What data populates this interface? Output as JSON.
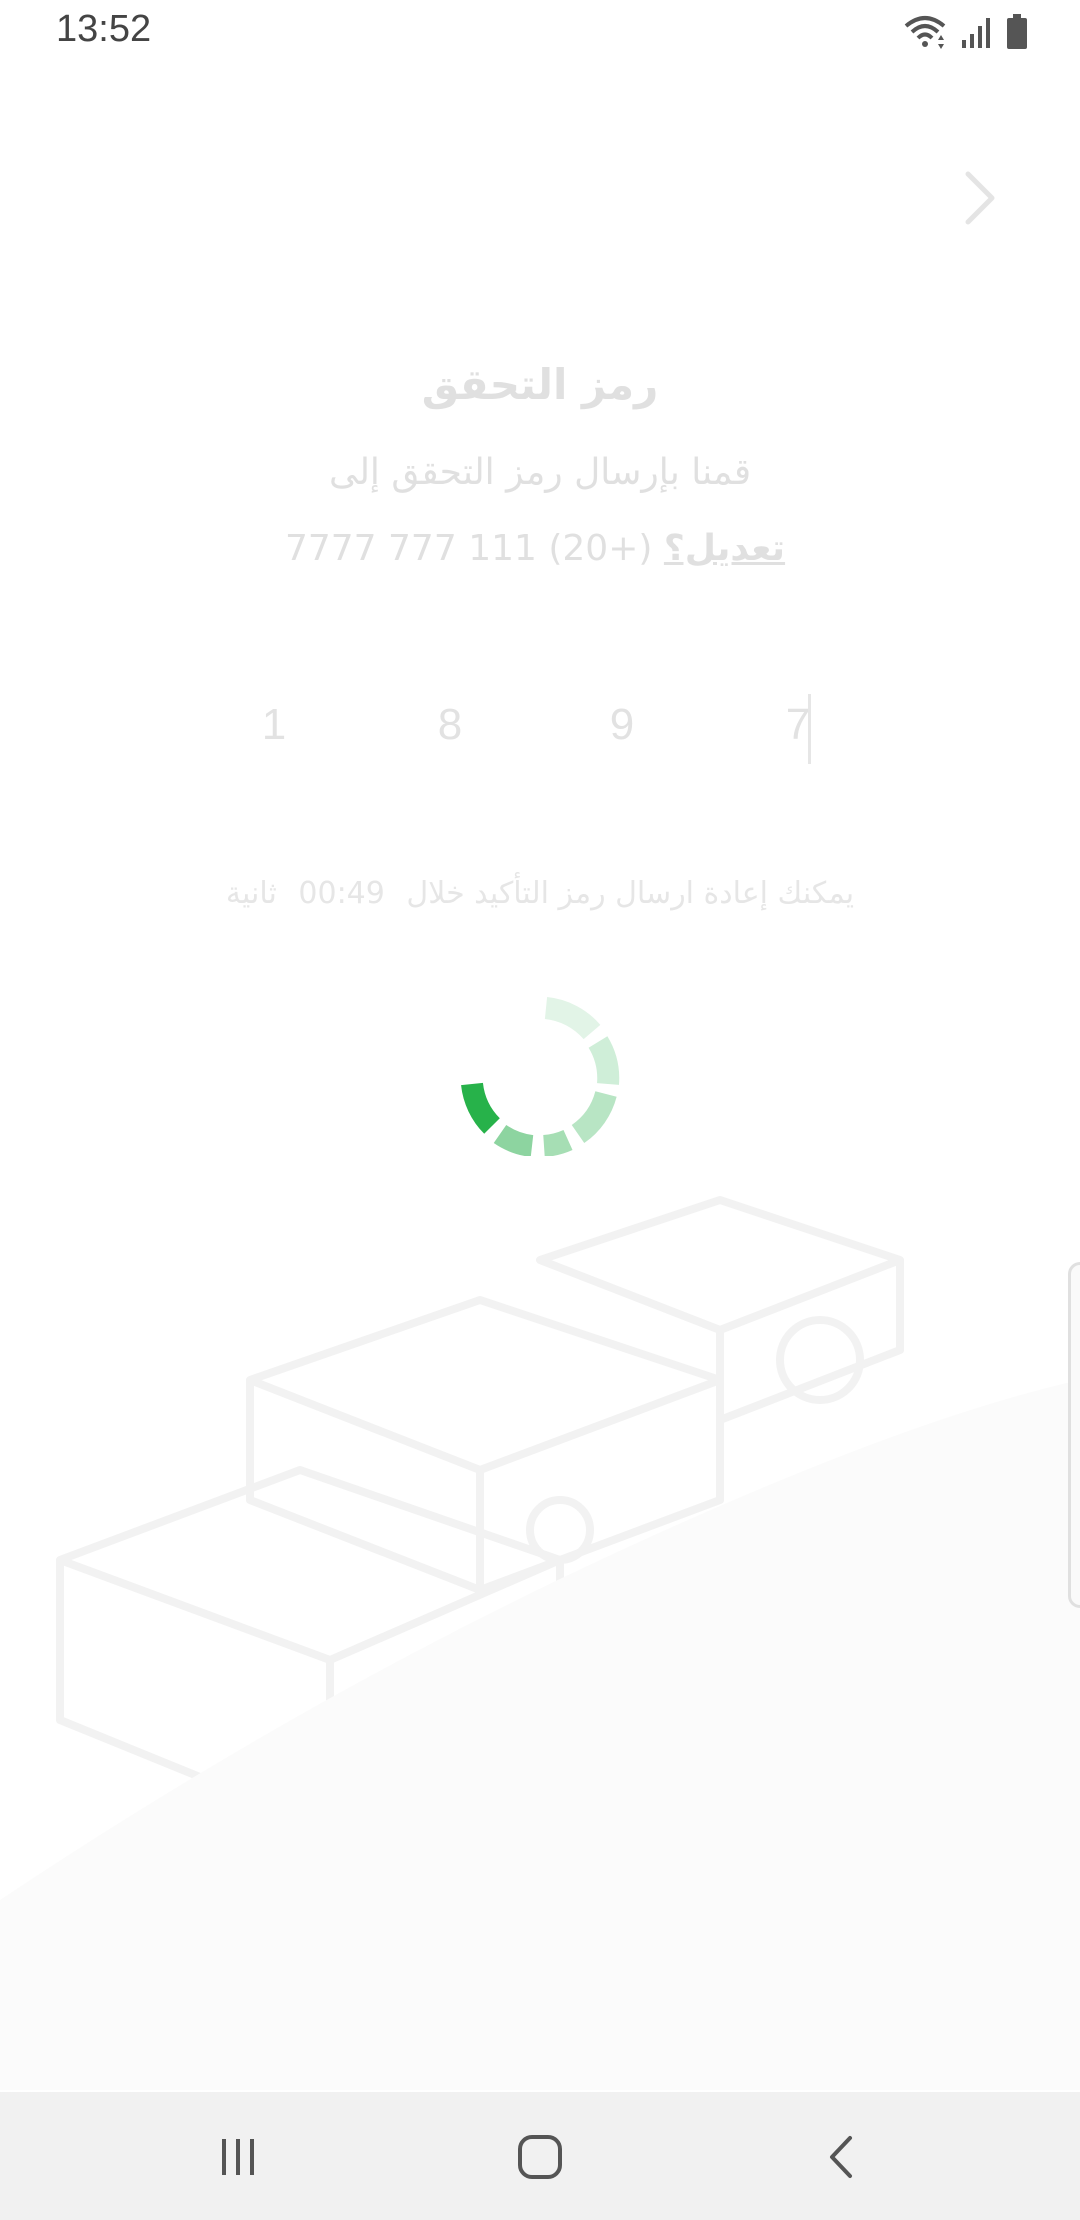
{
  "status": {
    "time": "13:52",
    "icons": [
      "wifi-icon",
      "signal-icon",
      "battery-icon"
    ]
  },
  "header": {
    "back_icon": "chevron-right-icon"
  },
  "verify": {
    "title": "رمز التحقق",
    "subtitle": "قمنا بإرسال رمز التحقق إلى",
    "phone": "(+20) 111 777 7777",
    "edit_label": "تعديل؟"
  },
  "otp": {
    "digits": [
      "7",
      "9",
      "8",
      "1"
    ]
  },
  "resend": {
    "text": "يمكنك إعادة ارسال رمز التأكيد خلال",
    "timer": "00:49",
    "unit": "ثانية"
  },
  "loading": {
    "accent_color": "#27b24a"
  },
  "nav": {
    "recent_icon": "recent-apps-icon",
    "home_icon": "home-icon",
    "back_icon": "back-icon"
  }
}
